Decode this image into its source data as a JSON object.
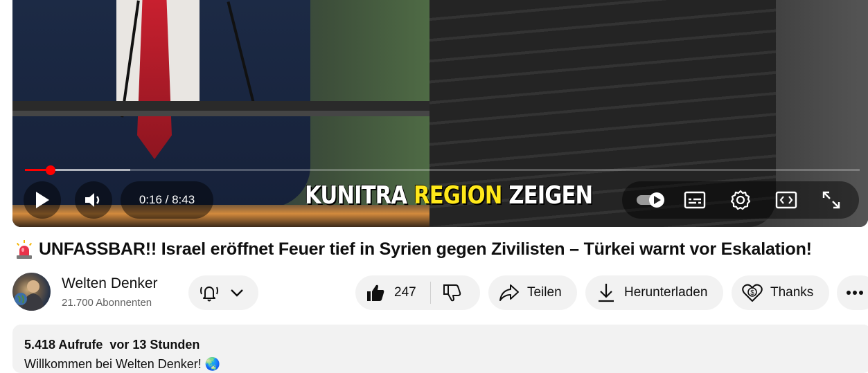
{
  "player": {
    "time_current": "0:16",
    "time_separator": " / ",
    "time_total": "8:43",
    "progress_fraction": 0.031,
    "buffered_fraction": 0.126,
    "subtitle_pre": "KUNITRA ",
    "subtitle_highlight": "REGION",
    "subtitle_post": " ZEIGEN",
    "subtitle_highlight_color": "#ffe81a",
    "progress_color": "#ff0000",
    "icons": [
      "play-icon",
      "volume-icon",
      "autoplay-toggle-icon",
      "subtitles-icon",
      "settings-icon",
      "theater-mode-icon",
      "fullscreen-icon"
    ]
  },
  "video": {
    "title": "UNFASSBAR!! Israel eröffnet Feuer tief in Syrien gegen Zivilisten – Türkei warnt vor Eskalation!",
    "title_emoji_icon": "siren-icon"
  },
  "channel": {
    "name": "Welten Denker",
    "subscribers": "21.700 Abonnenten"
  },
  "actions": {
    "like_count": "247",
    "share_label": "Teilen",
    "download_label": "Herunterladen",
    "thanks_label": "Thanks"
  },
  "description": {
    "views": "5.418 Aufrufe",
    "age": "vor 13 Stunden",
    "text": "Willkommen bei Welten Denker! 🌏"
  }
}
